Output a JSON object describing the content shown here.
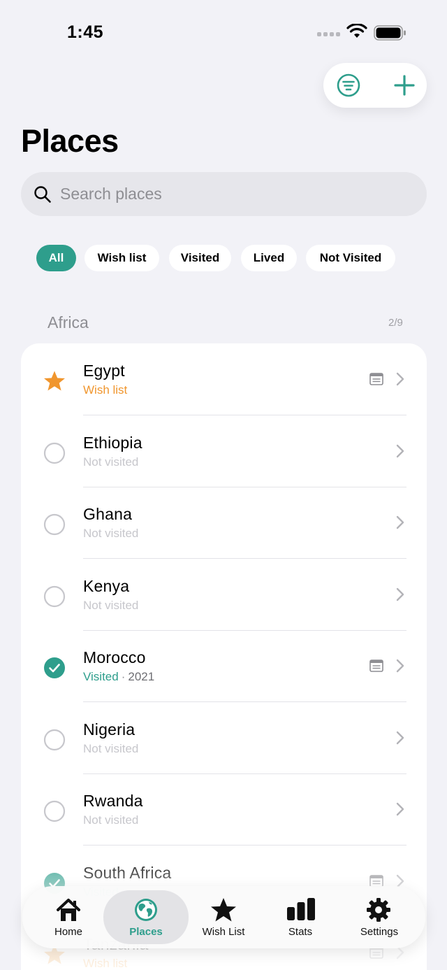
{
  "status_bar": {
    "time": "1:45"
  },
  "page": {
    "title": "Places"
  },
  "search": {
    "placeholder": "Search places"
  },
  "filters": [
    {
      "label": "All",
      "active": true
    },
    {
      "label": "Wish list",
      "active": false
    },
    {
      "label": "Visited",
      "active": false
    },
    {
      "label": "Lived",
      "active": false
    },
    {
      "label": "Not Visited",
      "active": false
    }
  ],
  "section": {
    "title": "Africa",
    "count": "2/9"
  },
  "places": [
    {
      "name": "Egypt",
      "status": "Wish list",
      "status_type": "wish",
      "year": "",
      "has_note": true
    },
    {
      "name": "Ethiopia",
      "status": "Not visited",
      "status_type": "none",
      "year": "",
      "has_note": false
    },
    {
      "name": "Ghana",
      "status": "Not visited",
      "status_type": "none",
      "year": "",
      "has_note": false
    },
    {
      "name": "Kenya",
      "status": "Not visited",
      "status_type": "none",
      "year": "",
      "has_note": false
    },
    {
      "name": "Morocco",
      "status": "Visited",
      "status_type": "visited",
      "year": "2021",
      "has_note": true
    },
    {
      "name": "Nigeria",
      "status": "Not visited",
      "status_type": "none",
      "year": "",
      "has_note": false
    },
    {
      "name": "Rwanda",
      "status": "Not visited",
      "status_type": "none",
      "year": "",
      "has_note": false
    },
    {
      "name": "South Africa",
      "status": "Visited",
      "status_type": "visited",
      "year": "",
      "has_note": true
    },
    {
      "name": "Tanzania",
      "status": "Wish list",
      "status_type": "wish",
      "year": "",
      "has_note": true
    }
  ],
  "tabs": [
    {
      "label": "Home",
      "icon": "house-icon",
      "active": false
    },
    {
      "label": "Places",
      "icon": "globe-icon",
      "active": true
    },
    {
      "label": "Wish List",
      "icon": "star-icon",
      "active": false
    },
    {
      "label": "Stats",
      "icon": "bar-chart-icon",
      "active": false
    },
    {
      "label": "Settings",
      "icon": "gear-icon",
      "active": false
    }
  ],
  "colors": {
    "accent": "#2e9e8c",
    "wish": "#f0962e",
    "not_visited": "#c7c7cc",
    "background": "#f2f2f7"
  }
}
